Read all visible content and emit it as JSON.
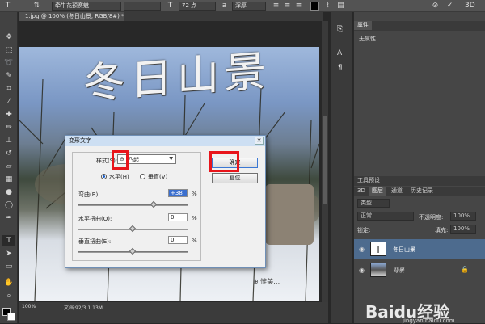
{
  "options_bar": {
    "font_family": "牵牛花预赛魅",
    "font_size": "72 点",
    "antialias": "浑厚"
  },
  "document": {
    "tab_label": "1.jpg @ 100% (冬日山景, RGB/8#) *",
    "overlay_text": "冬日山景"
  },
  "properties_panel": {
    "tab": "属性",
    "body": "无属性"
  },
  "layers_panel": {
    "title": "工具预设",
    "tabs": [
      "3D",
      "图层",
      "通道",
      "历史记录"
    ],
    "filter_kind": "类型",
    "blend_mode": "正常",
    "opacity_label": "不透明度:",
    "opacity_value": "100%",
    "lock_label": "锁定:",
    "fill_label": "填充:",
    "fill_value": "100%",
    "layers": [
      {
        "name": "冬日山景",
        "type": "text"
      },
      {
        "name": "背景",
        "type": "image"
      }
    ]
  },
  "dialog": {
    "title": "变形文字",
    "style_label": "样式(S):",
    "style_value": "凸起",
    "horizontal_label": "水平(H)",
    "vertical_label": "垂直(V)",
    "bend_label": "弯曲(B):",
    "bend_value": "+38",
    "hdistort_label": "水平扭曲(O):",
    "hdistort_value": "0",
    "vdistort_label": "垂直扭曲(E):",
    "vdistort_value": "0",
    "percent": "%",
    "ok_label": "确定",
    "reset_label": "复位",
    "bend_fraction": 0.69,
    "hdistort_fraction": 0.5,
    "vdistort_fraction": 0.5
  },
  "status": {
    "zoom": "100%",
    "doc_info": "文档:92/3.1.13M"
  },
  "watermark": {
    "brand": "Baidu经验",
    "url": "jingyan.baidu.com"
  },
  "colors": {
    "highlight": "#e8151b",
    "layer_selected": "#4d6b8e"
  }
}
